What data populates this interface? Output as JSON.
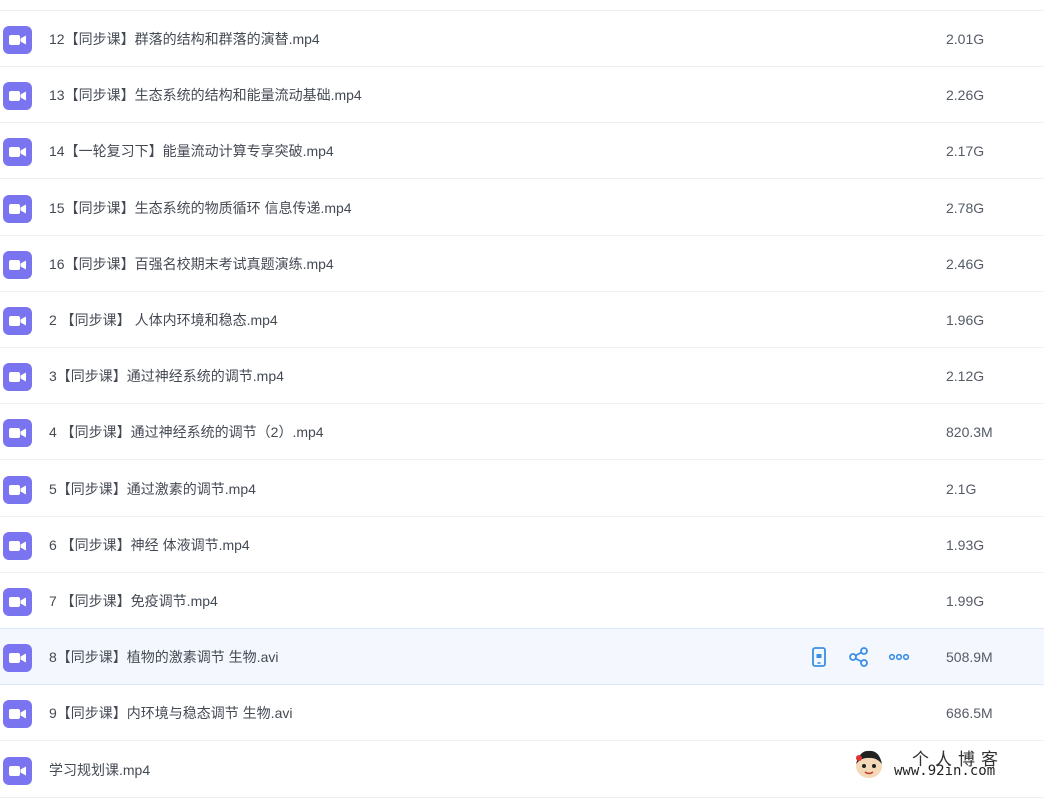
{
  "files": [
    {
      "name": "12【同步课】群落的结构和群落的演替.mp4",
      "size": "2.01G"
    },
    {
      "name": "13【同步课】生态系统的结构和能量流动基础.mp4",
      "size": "2.26G"
    },
    {
      "name": "14【一轮复习下】能量流动计算专享突破.mp4",
      "size": "2.17G"
    },
    {
      "name": "15【同步课】生态系统的物质循环 信息传递.mp4",
      "size": "2.78G"
    },
    {
      "name": "16【同步课】百强名校期末考试真题演练.mp4",
      "size": "2.46G"
    },
    {
      "name": "2 【同步课】 人体内环境和稳态.mp4",
      "size": "1.96G"
    },
    {
      "name": "3【同步课】通过神经系统的调节.mp4",
      "size": "2.12G"
    },
    {
      "name": "4 【同步课】通过神经系统的调节（2）.mp4",
      "size": "820.3M"
    },
    {
      "name": "5【同步课】通过激素的调节.mp4",
      "size": "2.1G"
    },
    {
      "name": "6 【同步课】神经 体液调节.mp4",
      "size": "1.93G"
    },
    {
      "name": "7 【同步课】免疫调节.mp4",
      "size": "1.99G"
    },
    {
      "name": "8【同步课】植物的激素调节 生物.avi",
      "size": "508.9M",
      "hovered": true
    },
    {
      "name": "9【同步课】内环境与稳态调节 生物.avi",
      "size": "686.5M"
    },
    {
      "name": "学习规划课.mp4",
      "size": ""
    }
  ],
  "icons": {
    "file": "video-file-icon",
    "row_actions": [
      "phone-icon",
      "share-icon",
      "more-icon"
    ]
  },
  "colors": {
    "video_icon": "#7b74f0",
    "action_icon": "#3a8ee6",
    "hover_row": "#f4f8fe"
  },
  "watermark": {
    "title": "个人博客",
    "url": "www.92in.com"
  }
}
